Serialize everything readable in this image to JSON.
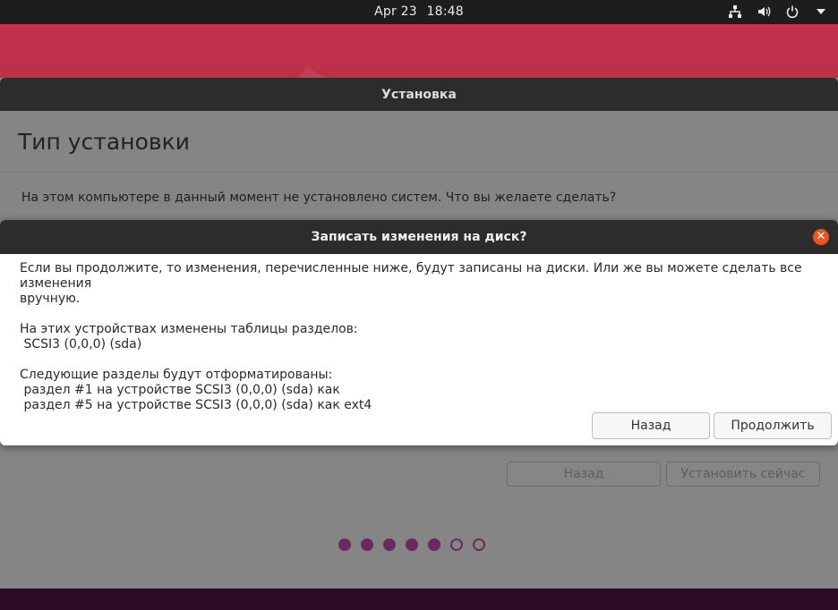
{
  "topbar": {
    "date": "Apr 23",
    "time": "18:48",
    "icons": [
      "network-icon",
      "volume-icon",
      "power-icon",
      "menu-arrow-icon"
    ]
  },
  "installer": {
    "window_title": "Установка",
    "page_title": "Тип установки",
    "question": "На этом компьютере в данный момент не установлено систем. Что вы желаете сделать?",
    "back_label": "Назад",
    "install_label": "Установить сейчас",
    "progress": {
      "total": 7,
      "completed": 5
    }
  },
  "dialog": {
    "title": "Записать изменения на диск?",
    "intro_line1": "Если вы продолжите, то изменения, перечисленные ниже, будут записаны на диски. Или же вы можете сделать все изменения",
    "intro_line2": "вручную.",
    "tables_heading": "На этих устройствах изменены таблицы разделов:",
    "tables_devices": [
      " SCSI3 (0,0,0) (sda)"
    ],
    "format_heading": "Следующие разделы будут отформатированы:",
    "format_items": [
      " раздел #1 на устройстве SCSI3 (0,0,0) (sda) как",
      " раздел #5 на устройстве SCSI3 (0,0,0) (sda) как ext4"
    ],
    "back_label": "Назад",
    "continue_label": "Продолжить"
  },
  "colors": {
    "accent": "#e95420",
    "progress_dot": "#6b2a5f",
    "titlebar": "#2c2c2c"
  }
}
